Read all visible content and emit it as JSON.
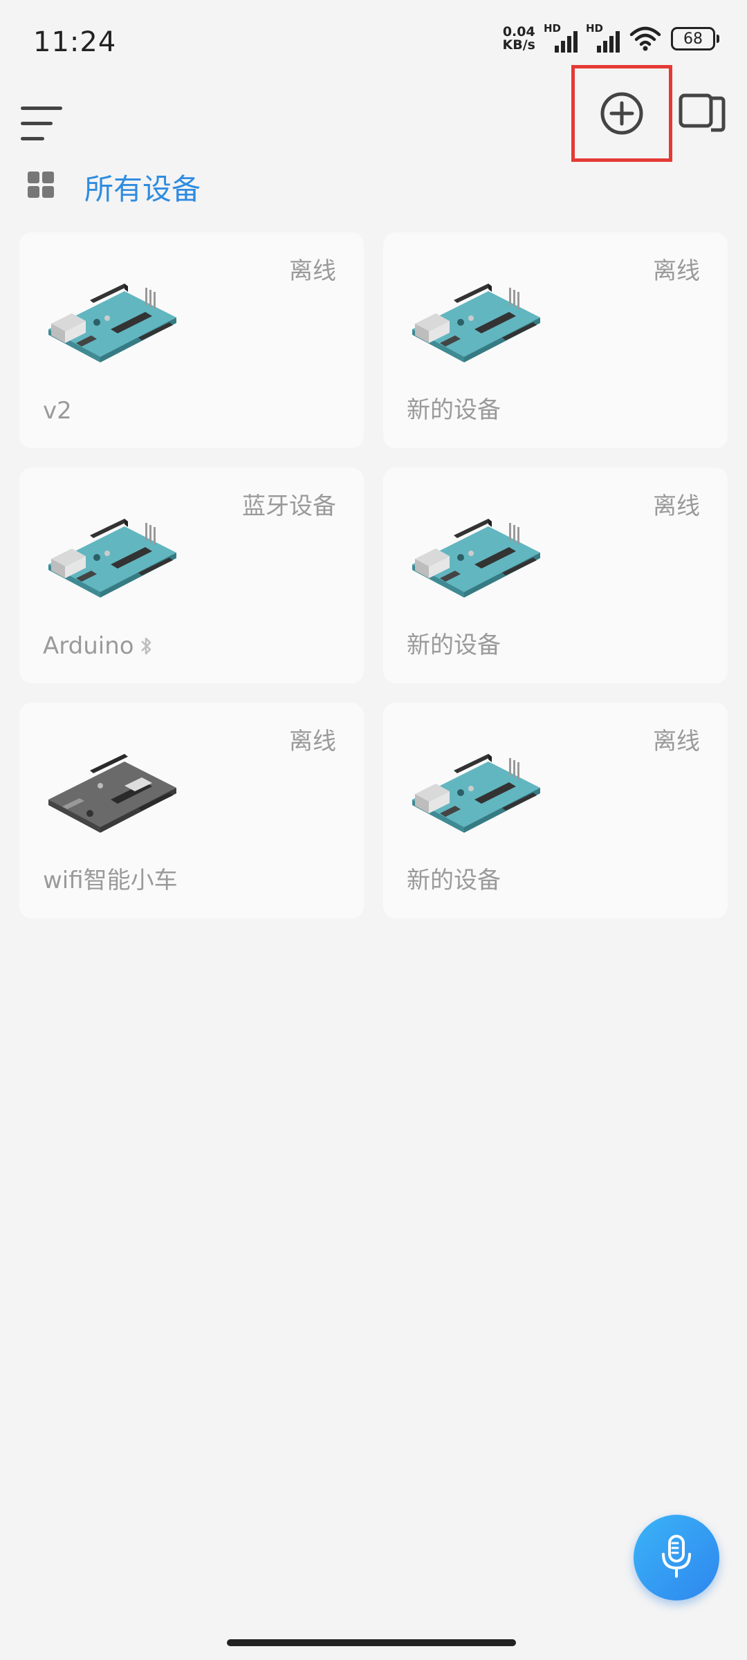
{
  "status_bar": {
    "time": "11:24",
    "net_speed_value": "0.04",
    "net_speed_unit": "KB/s",
    "signal1_label": "HD",
    "signal2_label": "HD",
    "battery_level": "68"
  },
  "header": {
    "menu_icon": "hamburger-menu-icon",
    "add_icon": "add-circle-icon",
    "multi_icon": "multi-window-icon"
  },
  "group": {
    "title": "所有设备"
  },
  "devices": [
    {
      "name": "v2",
      "status": "离线",
      "board": "arduino-uno"
    },
    {
      "name": "新的设备",
      "status": "离线",
      "board": "arduino-uno"
    },
    {
      "name": "Arduino",
      "status": "蓝牙设备",
      "board": "arduino-uno",
      "icon": "bluetooth-icon"
    },
    {
      "name": "新的设备",
      "status": "离线",
      "board": "arduino-uno"
    },
    {
      "name": "wifi智能小车",
      "status": "离线",
      "board": "wifi-board-gray"
    },
    {
      "name": "新的设备",
      "status": "离线",
      "board": "arduino-uno"
    }
  ],
  "fab": {
    "icon": "microphone-icon"
  },
  "colors": {
    "accent": "#2f8ce0",
    "highlight_box": "#e53935",
    "board_teal": "#5fb3bc",
    "fab": "#2e86ee"
  }
}
